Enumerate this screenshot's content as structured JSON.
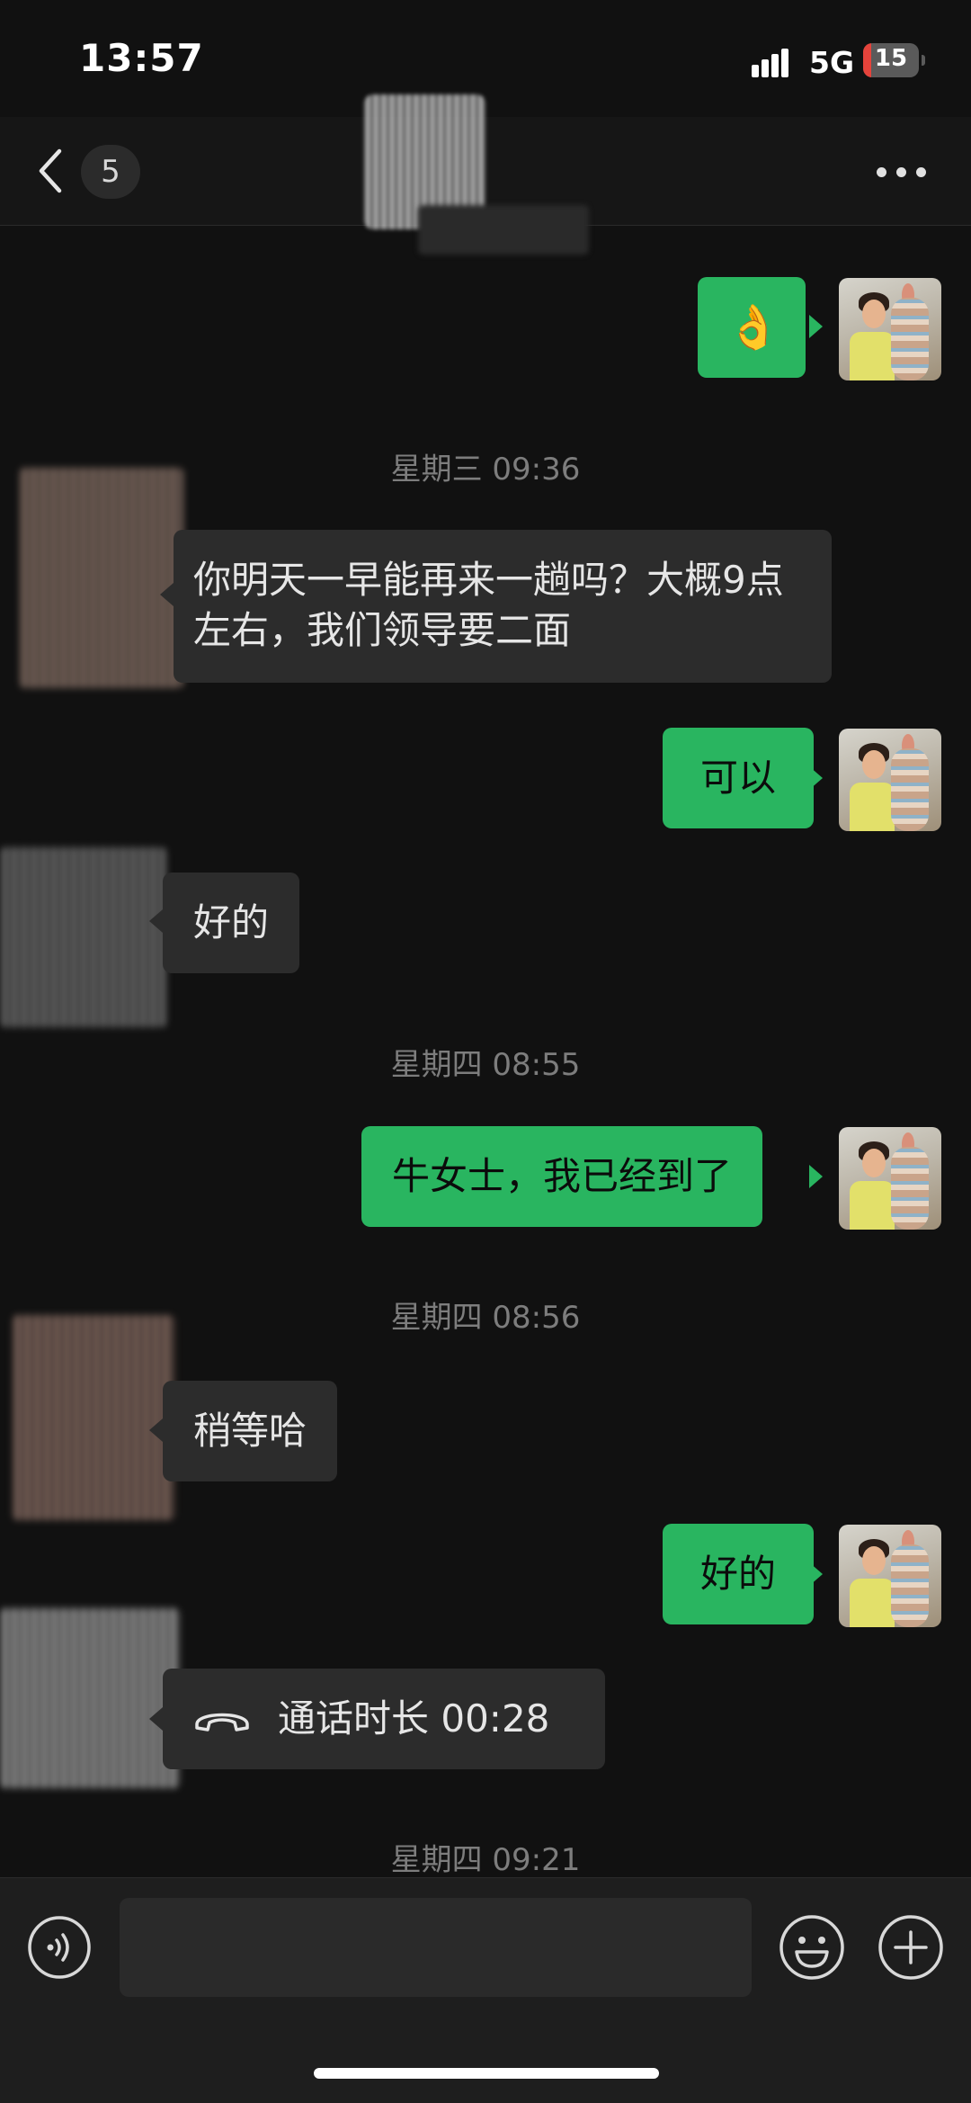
{
  "status_bar": {
    "time": "13:57",
    "network": "5G",
    "battery": "15",
    "battery_level": 0.15
  },
  "nav": {
    "unread_count": "5"
  },
  "messages": [
    {
      "type": "text",
      "dir": "out",
      "text": "👌"
    },
    {
      "type": "time",
      "text": "星期三 09:36"
    },
    {
      "type": "text",
      "dir": "in",
      "text": "你明天一早能再来一趟吗？大概9点左右，我们领导要二面"
    },
    {
      "type": "text",
      "dir": "out",
      "text": "可以"
    },
    {
      "type": "text",
      "dir": "in",
      "text": "好的"
    },
    {
      "type": "time",
      "text": "星期四 08:55"
    },
    {
      "type": "text",
      "dir": "out",
      "text": "牛女士，我已经到了"
    },
    {
      "type": "time",
      "text": "星期四 08:56"
    },
    {
      "type": "text",
      "dir": "in",
      "text": "稍等哈"
    },
    {
      "type": "text",
      "dir": "out",
      "text": "好的"
    },
    {
      "type": "call",
      "dir": "in",
      "text": "通话时长 00:28"
    },
    {
      "type": "time",
      "text": "星期四 09:21"
    }
  ],
  "icons": {
    "back": "chevron-left-icon",
    "more": "more-dots-icon",
    "call": "phone-hangup-icon",
    "voice": "voice-input-icon",
    "emoji": "emoji-smile-icon",
    "plus": "plus-icon"
  },
  "colors": {
    "sent_bubble": "#29b560",
    "received_bubble": "#2c2c2c",
    "background": "#111111"
  }
}
